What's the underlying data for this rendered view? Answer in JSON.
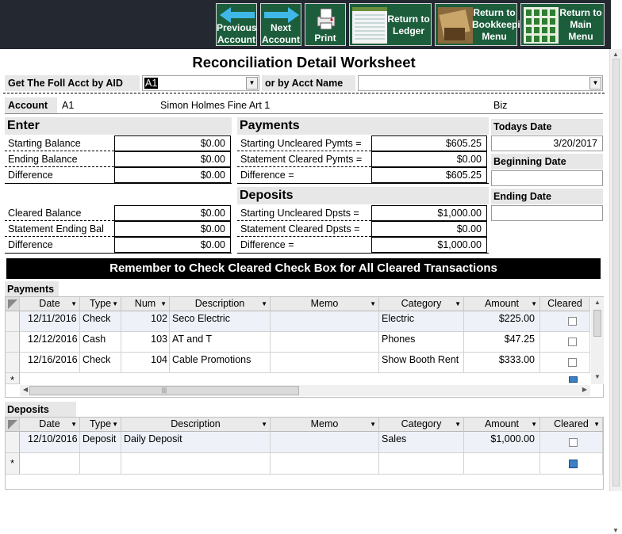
{
  "nav": {
    "prev": [
      "Previous",
      "Account"
    ],
    "next": [
      "Next",
      "Account"
    ],
    "print": "Print",
    "ledger": [
      "Return to",
      "Ledger"
    ],
    "bookkeeping": [
      "Return to",
      "Bookkeeping",
      "Menu"
    ],
    "main": [
      "Return to",
      "Main",
      "Menu"
    ]
  },
  "title": "Reconciliation Detail Worksheet",
  "lookup": {
    "aid_label": "Get The Foll Acct by AID",
    "aid_value": "A1",
    "name_label": "or by Acct Name",
    "name_value": ""
  },
  "account": {
    "label": "Account",
    "id": "A1",
    "name": "Simon Holmes Fine Art 1",
    "type": "Biz"
  },
  "enter": {
    "heading": "Enter",
    "rows": [
      {
        "label": "Starting Balance",
        "value": "$0.00"
      },
      {
        "label": "Ending Balance",
        "value": "$0.00"
      },
      {
        "label": "Difference",
        "value": "$0.00"
      }
    ],
    "rows2": [
      {
        "label": "Cleared Balance",
        "value": "$0.00"
      },
      {
        "label": "Statement Ending Bal",
        "value": "$0.00"
      },
      {
        "label": "Difference",
        "value": "$0.00"
      }
    ]
  },
  "payments_summary": {
    "heading": "Payments",
    "rows": [
      {
        "label": "Starting Uncleared Pymts =",
        "value": "$605.25"
      },
      {
        "label": "Statement Cleared Pymts =",
        "value": "$0.00"
      },
      {
        "label": "Difference =",
        "value": "$605.25"
      }
    ]
  },
  "deposits_summary": {
    "heading": "Deposits",
    "rows": [
      {
        "label": "Starting Uncleared Dpsts =",
        "value": "$1,000.00"
      },
      {
        "label": "Statement Cleared Dpsts =",
        "value": "$0.00"
      },
      {
        "label": "Difference =",
        "value": "$1,000.00"
      }
    ]
  },
  "dates": {
    "today_label": "Todays Date",
    "today_value": "3/20/2017",
    "begin_label": "Beginning  Date",
    "begin_value": "",
    "end_label": "Ending Date",
    "end_value": ""
  },
  "banner": "Remember to Check Cleared Check Box for All Cleared Transactions",
  "payments_grid": {
    "label": "Payments",
    "columns": [
      "Date",
      "Type",
      "Num",
      "Description",
      "Memo",
      "Category",
      "Amount",
      "Cleared"
    ],
    "rows": [
      {
        "date": "12/11/2016",
        "type": "Check",
        "num": "102",
        "desc": "Seco Electric",
        "memo": "",
        "cat": "Electric",
        "amount": "$225.00"
      },
      {
        "date": "12/12/2016",
        "type": "Cash",
        "num": "103",
        "desc": "AT and T",
        "memo": "",
        "cat": "Phones",
        "amount": "$47.25"
      },
      {
        "date": "12/16/2016",
        "type": "Check",
        "num": "104",
        "desc": "Cable Promotions",
        "memo": "",
        "cat": "Show Booth Rent",
        "amount": "$333.00"
      }
    ],
    "new_row_marker": "*"
  },
  "deposits_grid": {
    "label": "Deposits",
    "columns": [
      "Date",
      "Type",
      "Description",
      "Memo",
      "Category",
      "Amount",
      "Cleared"
    ],
    "rows": [
      {
        "date": "12/10/2016",
        "type": "Deposit",
        "desc": "Daily Deposit",
        "memo": "",
        "cat": "Sales",
        "amount": "$1,000.00"
      }
    ],
    "new_row_marker": "*"
  },
  "colors": {
    "topbar": "#232831",
    "nav_button": "#1c5e3c",
    "arrow": "#3fb8e8",
    "banner": "#000000",
    "section_bg": "#e7e7e7"
  }
}
